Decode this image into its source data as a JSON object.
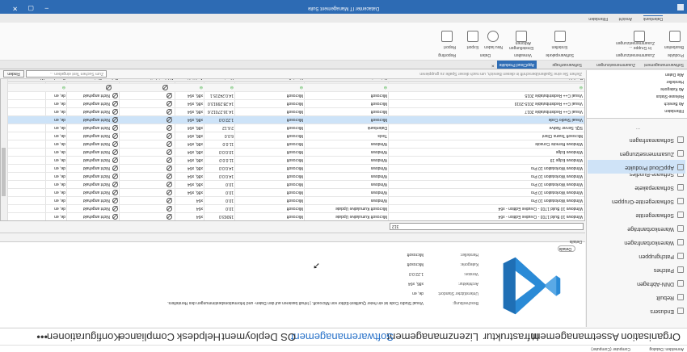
{
  "app": {
    "title": "Datacenter IT Management Suite",
    "top_left": [
      "Anmelden: Datalog",
      "Computer (Computer)"
    ]
  },
  "menu": [
    {
      "label": "Organisation"
    },
    {
      "label": "Assetmanagement"
    },
    {
      "label": "Infrastruktur"
    },
    {
      "label": "Lizenzmanagement"
    },
    {
      "label": "Softwaremanagement",
      "active": true
    },
    {
      "label": "OS Deployment"
    },
    {
      "label": "Helpdesk"
    },
    {
      "label": "Compliance"
    },
    {
      "label": "Konfigurationen"
    },
    {
      "label": "•••"
    }
  ],
  "sidebar": {
    "items": [
      {
        "label": "Endusers"
      },
      {
        "label": "Rebuilt"
      },
      {
        "label": "DNN-Abfragen"
      },
      {
        "label": "Patches"
      },
      {
        "label": "Patchgruppen"
      },
      {
        "label": "Warenkorbanfragen"
      },
      {
        "label": "Warenkorbanträge"
      },
      {
        "label": "Softwaregeräte"
      },
      {
        "label": "Softwaregeräte-Gruppen"
      },
      {
        "label": "Softwarepakete"
      },
      {
        "label": "Software-Bundles"
      },
      {
        "label": "AppCloud Produkte",
        "selected": true
      },
      {
        "label": "Zusammensetzungen"
      },
      {
        "label": "Softwareanfragen"
      }
    ],
    "more": "..."
  },
  "tree": [
    "Filterdaten",
    "Ab Bereich",
    "Release-Status",
    "Ab Kategorie",
    "Hersteller",
    "Alle Daten"
  ],
  "detail": {
    "properties": [
      {
        "key": "Beschreibung:",
        "value": "Visual Studio Code ist ein freier Quelltext-Editor von Microsoft. | Inhalt basieren auf den Daten- und Informationsbestimmungen des Herstellers."
      },
      {
        "key": "Unterstützter Standort:",
        "value": "de, en"
      },
      {
        "key": "Architektur:",
        "value": "x86, x64"
      },
      {
        "key": "Version:",
        "value": "1.22.0.0"
      },
      {
        "key": "Kategorie:",
        "value": "Microsoft"
      },
      {
        "key": "Hersteller:",
        "value": "Microsoft"
      }
    ],
    "details_button": "Details",
    "details_label": "Details"
  },
  "grid": {
    "search_value": "312",
    "columns": [
      "Produkt",
      "Kategorie",
      "Hersteller",
      "Version",
      "Architektur",
      "Abhängigkeiten",
      "Release-Status",
      "Sprache",
      "Warnungen"
    ],
    "rows": [
      {
        "produkt": "Windows 10 Build 1703 - Creative Edition - x64",
        "kategorie": "Microsoft Kumulative Update",
        "hersteller": "Microsoft",
        "version": "15063.0",
        "arch": "x64",
        "status": "Nicht angehakt",
        "sprache": "de, en"
      },
      {
        "produkt": "Windows 10 Build 1703 - Creative Edition - x64",
        "kategorie": "Microsoft Kumulative Update",
        "hersteller": "Microsoft",
        "version": "10.0",
        "arch": "x64",
        "status": "Nicht angehakt",
        "sprache": "de, en"
      },
      {
        "produkt": "Windows Workstation 10 Pro",
        "kategorie": "Windows",
        "hersteller": "Microsoft",
        "version": "10.0",
        "arch": "x64",
        "status": "Nicht angehakt",
        "sprache": "de, en"
      },
      {
        "produkt": "Windows Workstation 10 Pro",
        "kategorie": "Windows",
        "hersteller": "Microsoft",
        "version": "10.0",
        "arch": "x86, x64",
        "status": "Nicht angehakt",
        "sprache": "de, en"
      },
      {
        "produkt": "Windows Workstation 10 Pro",
        "kategorie": "Windows",
        "hersteller": "Microsoft",
        "version": "10.0",
        "arch": "x86, x64",
        "status": "Nicht angehakt",
        "sprache": "de, en"
      },
      {
        "produkt": "Windows Workstation 10 Pro",
        "kategorie": "Windows",
        "hersteller": "Microsoft",
        "version": "14.0.0.0",
        "arch": "x86, x64",
        "status": "Nicht angehakt",
        "sprache": "de, en"
      },
      {
        "produkt": "Windows Workstation 10 Pro",
        "kategorie": "Windows",
        "hersteller": "Microsoft",
        "version": "14.0.0.0",
        "arch": "x86, x64",
        "status": "Nicht angehakt",
        "sprache": "de, en"
      },
      {
        "produkt": "Windows Edge 19",
        "kategorie": "Windows",
        "hersteller": "Microsoft",
        "version": "11.0.0.0",
        "arch": "x86, x64",
        "status": "Nicht angehakt",
        "sprache": "de, en"
      },
      {
        "produkt": "Windows Edge",
        "kategorie": "Windows",
        "hersteller": "Microsoft",
        "version": "10.0.0.0",
        "arch": "x86, x64",
        "status": "Nicht angehakt",
        "sprache": "de, en"
      },
      {
        "produkt": "Windows Remote Console",
        "kategorie": "Windows",
        "hersteller": "Microsoft",
        "version": "11.0.0",
        "arch": "x86, x64",
        "status": "Nicht angehakt",
        "sprache": "de, en"
      },
      {
        "produkt": "Microsoft Teams Client",
        "kategorie": "Tools",
        "hersteller": "Microsoft",
        "version": "6.0.0",
        "arch": "x86, x64",
        "status": "Nicht angehakt",
        "sprache": "de, en"
      },
      {
        "produkt": "SQL Server Native",
        "kategorie": "Datenbank",
        "hersteller": "Microsoft",
        "version": "2.6.12",
        "arch": "x86, x64",
        "status": "Nicht angehakt",
        "sprache": "de, en"
      },
      {
        "produkt": "Visual Studio Code",
        "kategorie": "Microsoft",
        "hersteller": "Microsoft",
        "version": "1.22.0.0",
        "arch": "x86, x64",
        "status": "Nicht angehakt",
        "sprache": "de, en",
        "selected": true
      },
      {
        "produkt": "Visual C++ Redistributable 2017",
        "kategorie": "Microsoft",
        "hersteller": "Microsoft",
        "version": "14.16.27012.6",
        "arch": "x86, x64",
        "status": "Nicht angehakt",
        "sprache": "de, en"
      },
      {
        "produkt": "Visual C++ Redistributable 2015-2019",
        "kategorie": "Microsoft",
        "hersteller": "Microsoft",
        "version": "14.28.29913.0",
        "arch": "x86, x64",
        "status": "Nicht angehakt",
        "sprache": "de, en"
      },
      {
        "produkt": "Visual C++ Redistributable 2015",
        "kategorie": "Microsoft",
        "hersteller": "Microsoft",
        "version": "14.0.24215.1",
        "arch": "x86, x64",
        "status": "Nicht angehakt",
        "sprache": "de, en"
      }
    ],
    "hint": "Ziehen Sie eine Spaltenüberschrift in diesen Bereich, um nach dieser Spalte zu gruppieren",
    "find_placeholder": "Zum Suchen Text eingeben ...",
    "find_button": "Finden"
  },
  "tabs": [
    {
      "label": "Softwaremanagement"
    },
    {
      "label": "Zusammensetzungen"
    },
    {
      "label": "Softwareanfrage"
    },
    {
      "label": "AppCloud Produkte",
      "active": true
    }
  ],
  "ribbon": {
    "groups": [
      {
        "title": "Produkte",
        "items": [
          "Bearbeiten"
        ]
      },
      {
        "title": "Zusammensetzungen",
        "items": [
          "In Gruppe ...",
          "Zusammensetzungen"
        ]
      },
      {
        "title": "Softwarepakete",
        "items": [
          "Erstellen"
        ]
      },
      {
        "title": "Verwalten",
        "items": [
          "Einstellungen",
          "Aktionen"
        ]
      },
      {
        "title": "Daten",
        "items": [
          "Neu laden",
          "Export"
        ]
      },
      {
        "title": "Reporting",
        "items": [
          "Report"
        ]
      }
    ]
  },
  "subtabs": [
    "Datenbank",
    "Ansicht",
    "Filterdaten"
  ],
  "colors": {
    "accent": "#2d6bb4",
    "active_menu": "#2a73c9",
    "vscode_blue": "#2a8ad6"
  }
}
